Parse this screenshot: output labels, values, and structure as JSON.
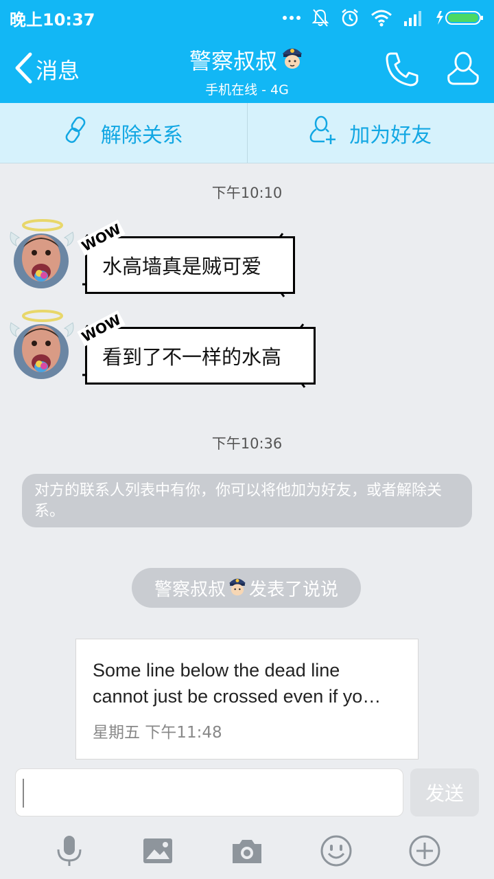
{
  "status_bar": {
    "time": "晚上10:37",
    "icons": [
      "more-dots-icon",
      "mute-bell-icon",
      "alarm-icon",
      "wifi-icon",
      "signal-icon",
      "battery-charging-icon"
    ]
  },
  "header": {
    "back_label": "消息",
    "title": "警察叔叔",
    "subtitle": "手机在线 - 4G",
    "title_emoji": "police-officer-emoji",
    "accent_color": "#12b7f5"
  },
  "action_bar": {
    "unbind_label": "解除关系",
    "add_friend_label": "加为好友",
    "background": "#d6f2fc",
    "text_color": "#12a7e3"
  },
  "chat": {
    "timestamp_1": "下午10:10",
    "bubble_sticker_text": "WOW",
    "messages": [
      {
        "text": "水高墙真是贼可爱",
        "avatar": "angel-face-avatar"
      },
      {
        "text": "看到了不一样的水高",
        "avatar": "angel-face-avatar"
      }
    ],
    "timestamp_2": "下午10:36",
    "system_message": "对方的联系人列表中有你，你可以将他加为好友，或者解除关系。",
    "feed_notice": {
      "name": "警察叔叔",
      "suffix": "发表了说说"
    },
    "feed_card": {
      "line1": "Some line below the dead line",
      "line2": "cannot just be crossed even if yo…",
      "meta": "星期五 下午11:48"
    }
  },
  "composer": {
    "input_value": "",
    "send_label": "发送",
    "tools": [
      "microphone-icon",
      "image-icon",
      "camera-icon",
      "emoji-icon",
      "plus-icon"
    ]
  }
}
